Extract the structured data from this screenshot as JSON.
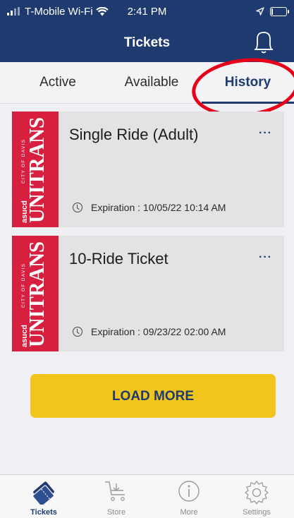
{
  "status_bar": {
    "carrier": "T-Mobile Wi-Fi",
    "time": "2:41 PM"
  },
  "header": {
    "title": "Tickets"
  },
  "tabs": [
    {
      "label": "Active"
    },
    {
      "label": "Available"
    },
    {
      "label": "History",
      "selected": true
    }
  ],
  "tickets": [
    {
      "name": "Single Ride (Adult)",
      "more": "···",
      "expiration": "Expiration : 10/05/22 10:14 AM"
    },
    {
      "name": "10-Ride Ticket",
      "more": "···",
      "expiration": "Expiration : 09/23/22 02:00 AM"
    }
  ],
  "logo": {
    "brand": "UNITRANS",
    "sub": "CITY OF DAVIS",
    "small": "asucd"
  },
  "load_more_label": "LOAD MORE",
  "tab_bar": [
    {
      "label": "Tickets",
      "icon": "tickets-icon",
      "active": true
    },
    {
      "label": "Store",
      "icon": "cart-icon"
    },
    {
      "label": "More",
      "icon": "info-icon"
    },
    {
      "label": "Settings",
      "icon": "gear-icon"
    }
  ],
  "colors": {
    "navy": "#1f3a6e",
    "unitrans_red": "#d71f3f",
    "load_more_yellow": "#f2c51c",
    "highlight_red": "#e6001a"
  }
}
